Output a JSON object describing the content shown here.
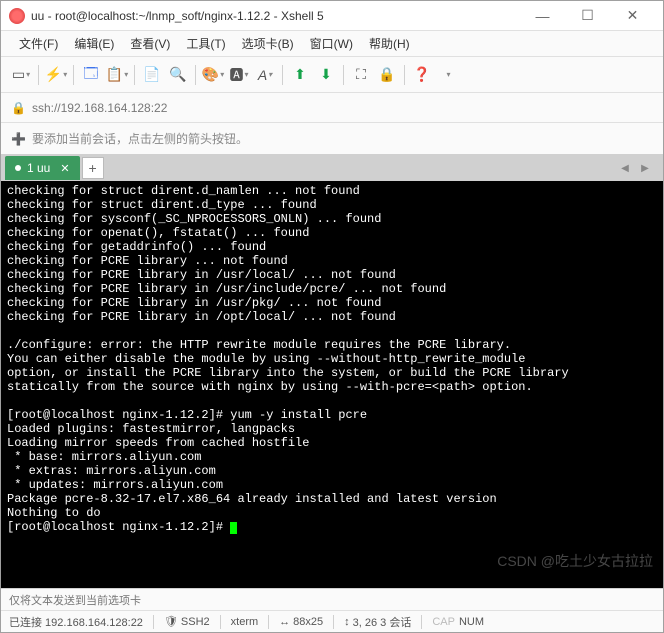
{
  "window": {
    "title": "uu - root@localhost:~/lnmp_soft/nginx-1.12.2 - Xshell 5",
    "min": "—",
    "max": "☐",
    "close": "✕"
  },
  "menu": {
    "file": "文件(F)",
    "edit": "编辑(E)",
    "view": "查看(V)",
    "tools": "工具(T)",
    "tab": "选项卡(B)",
    "window": "窗口(W)",
    "help": "帮助(H)"
  },
  "address": {
    "text": "ssh://192.168.164.128:22"
  },
  "hint": {
    "text": "要添加当前会话，点击左侧的箭头按钮。"
  },
  "tab": {
    "label": "1 uu",
    "add": "+"
  },
  "terminal": {
    "lines": [
      "checking for struct dirent.d_namlen ... not found",
      "checking for struct dirent.d_type ... found",
      "checking for sysconf(_SC_NPROCESSORS_ONLN) ... found",
      "checking for openat(), fstatat() ... found",
      "checking for getaddrinfo() ... found",
      "checking for PCRE library ... not found",
      "checking for PCRE library in /usr/local/ ... not found",
      "checking for PCRE library in /usr/include/pcre/ ... not found",
      "checking for PCRE library in /usr/pkg/ ... not found",
      "checking for PCRE library in /opt/local/ ... not found",
      "",
      "./configure: error: the HTTP rewrite module requires the PCRE library.",
      "You can either disable the module by using --without-http_rewrite_module",
      "option, or install the PCRE library into the system, or build the PCRE library",
      "statically from the source with nginx by using --with-pcre=<path> option.",
      "",
      "[root@localhost nginx-1.12.2]# yum -y install pcre",
      "Loaded plugins: fastestmirror, langpacks",
      "Loading mirror speeds from cached hostfile",
      " * base: mirrors.aliyun.com",
      " * extras: mirrors.aliyun.com",
      " * updates: mirrors.aliyun.com",
      "Package pcre-8.32-17.el7.x86_64 already installed and latest version",
      "Nothing to do",
      "[root@localhost nginx-1.12.2]# "
    ],
    "watermark": "CSDN @吃土少女古拉拉"
  },
  "footer": {
    "hint": "仅将文本发送到当前选项卡"
  },
  "status": {
    "conn": "已连接 192.168.164.128:22",
    "ssh": "SSH2",
    "term": "xterm",
    "size": "88x25",
    "extra": "3, 26 3 会话",
    "caps": "CAP",
    "num": "NUM"
  }
}
